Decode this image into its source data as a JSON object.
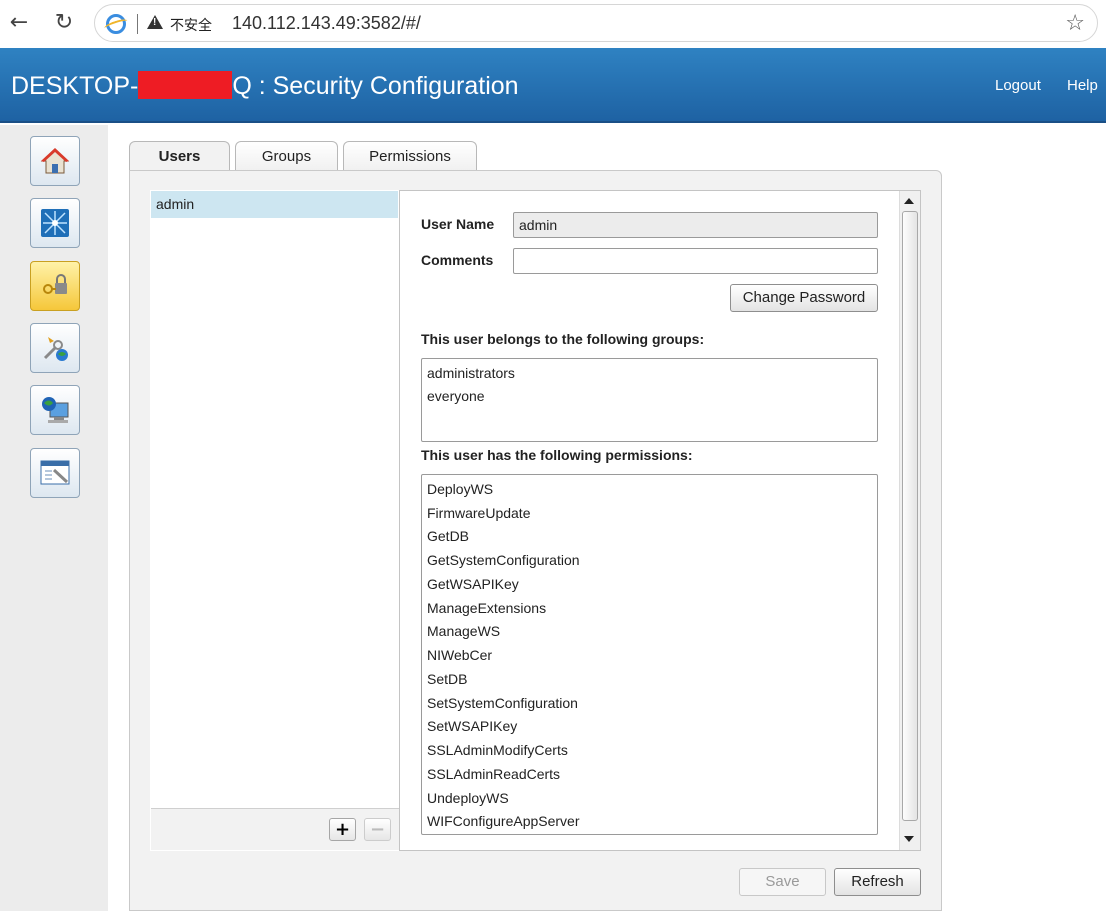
{
  "browser": {
    "security_label": "不安全",
    "url": "140.112.143.49:3582/#/"
  },
  "header": {
    "title_prefix": "DESKTOP-",
    "title_suffix": "Q : Security Configuration",
    "logout_label": "Logout",
    "help_label": "Help"
  },
  "sidebar": {
    "items": [
      "home",
      "network",
      "security",
      "tools-web",
      "remote-system",
      "configuration"
    ]
  },
  "tabs": [
    {
      "label": "Users",
      "active": true
    },
    {
      "label": "Groups",
      "active": false
    },
    {
      "label": "Permissions",
      "active": false
    }
  ],
  "users": {
    "items": [
      "admin"
    ],
    "selected": "admin",
    "add_label": "+",
    "remove_label": "−"
  },
  "details": {
    "username_label": "User Name",
    "username_value": "admin",
    "comments_label": "Comments",
    "comments_value": "",
    "change_password_label": "Change Password",
    "groups_heading": "This user belongs to the following groups:",
    "groups": [
      "administrators",
      "everyone"
    ],
    "permissions_heading": "This user has the following permissions:",
    "permissions": [
      "DeployWS",
      "FirmwareUpdate",
      "GetDB",
      "GetSystemConfiguration",
      "GetWSAPIKey",
      "ManageExtensions",
      "ManageWS",
      "NIWebCer",
      "SetDB",
      "SetSystemConfiguration",
      "SetWSAPIKey",
      "SSLAdminModifyCerts",
      "SSLAdminReadCerts",
      "UndeployWS",
      "WIFConfigureAppServer"
    ]
  },
  "footer": {
    "save_label": "Save",
    "refresh_label": "Refresh"
  },
  "colors": {
    "header_blue": "#2f82c2",
    "selection": "#cde6f1",
    "redaction": "#ee1c24"
  }
}
